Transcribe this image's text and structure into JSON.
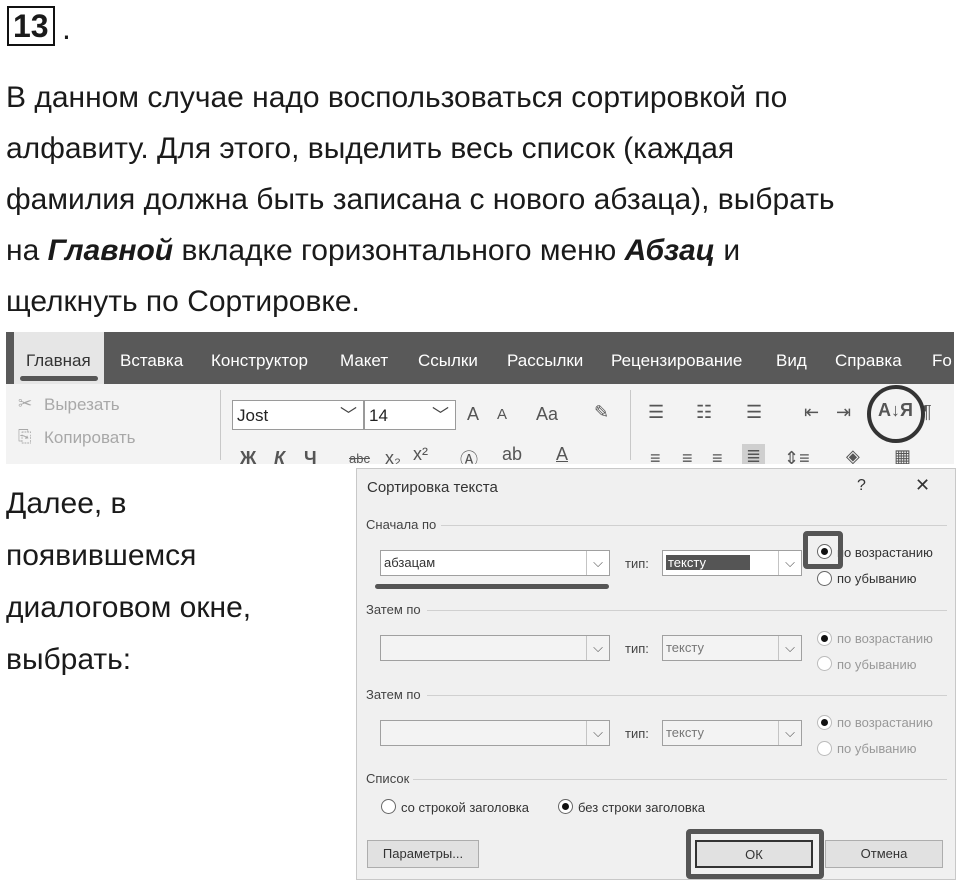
{
  "task": {
    "number": "13",
    "dot": "."
  },
  "intro": {
    "line1": "В данном случае надо воспользоваться сортировкой по",
    "line2": "алфавиту. Для этого, выделить весь список (каждая",
    "line3": "фамилия должна быть записана с нового абзаца), выбрать",
    "line4_pre": "на ",
    "line4_b1": "Главной",
    "line4_mid": " вкладке горизонтального меню ",
    "line4_b2": "Абзац",
    "line4_post": " и",
    "line5": "щелкнуть по Сортировке."
  },
  "ribbon": {
    "tabs": [
      "Главная",
      "Вставка",
      "Конструктор",
      "Макет",
      "Ссылки",
      "Рассылки",
      "Рецензирование",
      "Вид",
      "Справка",
      "Fo"
    ],
    "clipboard": {
      "cut": "Вырезать",
      "copy": "Копировать"
    },
    "font_name": "Jost",
    "font_size": "14",
    "font_btns": {
      "grow": "A",
      "shrink": "A",
      "case": "Aa",
      "bold": "Ж",
      "italic": "К",
      "underline": "Ч",
      "strike": "abc",
      "sub": "x₂",
      "sup": "x²",
      "color": "A"
    },
    "sort_glyph": "A↓Я"
  },
  "side": {
    "line1": " Далее, в",
    "line2": "появившемся",
    "line3": "диалоговом окне,",
    "line4": "выбрать:"
  },
  "dialog": {
    "title": "Сортировка текста",
    "help": "?",
    "close": "✕",
    "group1": "Сначала по",
    "group2": "Затем по",
    "group3": "Затем по",
    "group4": "Список",
    "sort1": "абзацам",
    "type_label": "тип:",
    "type1": "тексту",
    "type2": "тексту",
    "type3": "тексту",
    "asc": "по возрастанию",
    "desc": "по убыванию",
    "with_header": "со строкой заголовка",
    "no_header": "без строки заголовка",
    "options_btn": "Параметры...",
    "ok_btn": "ОК",
    "cancel_btn": "Отмена",
    "arrow": "⌵"
  }
}
